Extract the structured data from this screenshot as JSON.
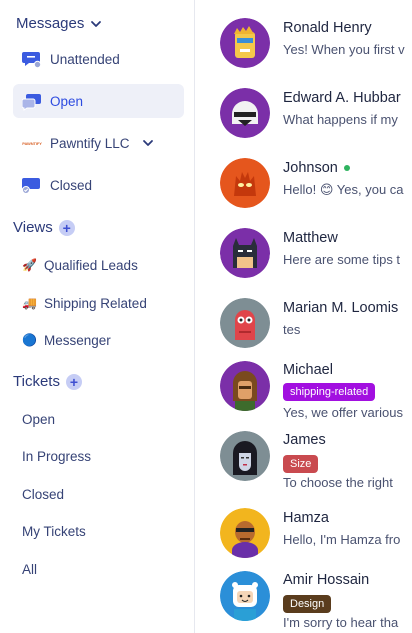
{
  "sidebar": {
    "messages": {
      "title": "Messages",
      "items": [
        {
          "label": "Unattended"
        },
        {
          "label": "Open"
        },
        {
          "label": "Pawntify LLC",
          "logo": "PAWNTIFY"
        },
        {
          "label": "Closed"
        }
      ]
    },
    "views": {
      "title": "Views",
      "items": [
        {
          "label": "Qualified Leads",
          "icon": "🚀"
        },
        {
          "label": "Shipping Related",
          "icon": "🚚"
        },
        {
          "label": "Messenger",
          "icon": "🔵"
        }
      ]
    },
    "tickets": {
      "title": "Tickets",
      "items": [
        {
          "label": "Open"
        },
        {
          "label": "In Progress"
        },
        {
          "label": "Closed"
        },
        {
          "label": "My Tickets"
        },
        {
          "label": "All"
        }
      ]
    }
  },
  "conversations": [
    {
      "name": "Ronald Henry",
      "preview": "Yes! When you first v"
    },
    {
      "name": "Edward A. Hubbar",
      "preview": "What happens if my"
    },
    {
      "name": "Johnson",
      "preview": "Hello! 😊 Yes, you ca",
      "online": true
    },
    {
      "name": "Matthew",
      "preview": "Here are some tips t"
    },
    {
      "name": "Marian M. Loomis",
      "preview": "tes"
    },
    {
      "name": "Michael",
      "tag": "shipping-related",
      "preview": "Yes, we offer various"
    },
    {
      "name": "James",
      "tag": "Size",
      "preview": "To choose the right"
    },
    {
      "name": "Hamza",
      "preview": "Hello, I'm Hamza fro"
    },
    {
      "name": "Amir Hossain",
      "tag": "Design",
      "preview": "I'm sorry to hear tha"
    }
  ],
  "colors": {
    "accent": "#3b4fd8",
    "active_bg": "#eef0f8",
    "tag_shipping": "#a20fe0",
    "tag_size": "#c94a4f",
    "tag_design": "#5a3c1d",
    "online": "#2fb35f"
  }
}
